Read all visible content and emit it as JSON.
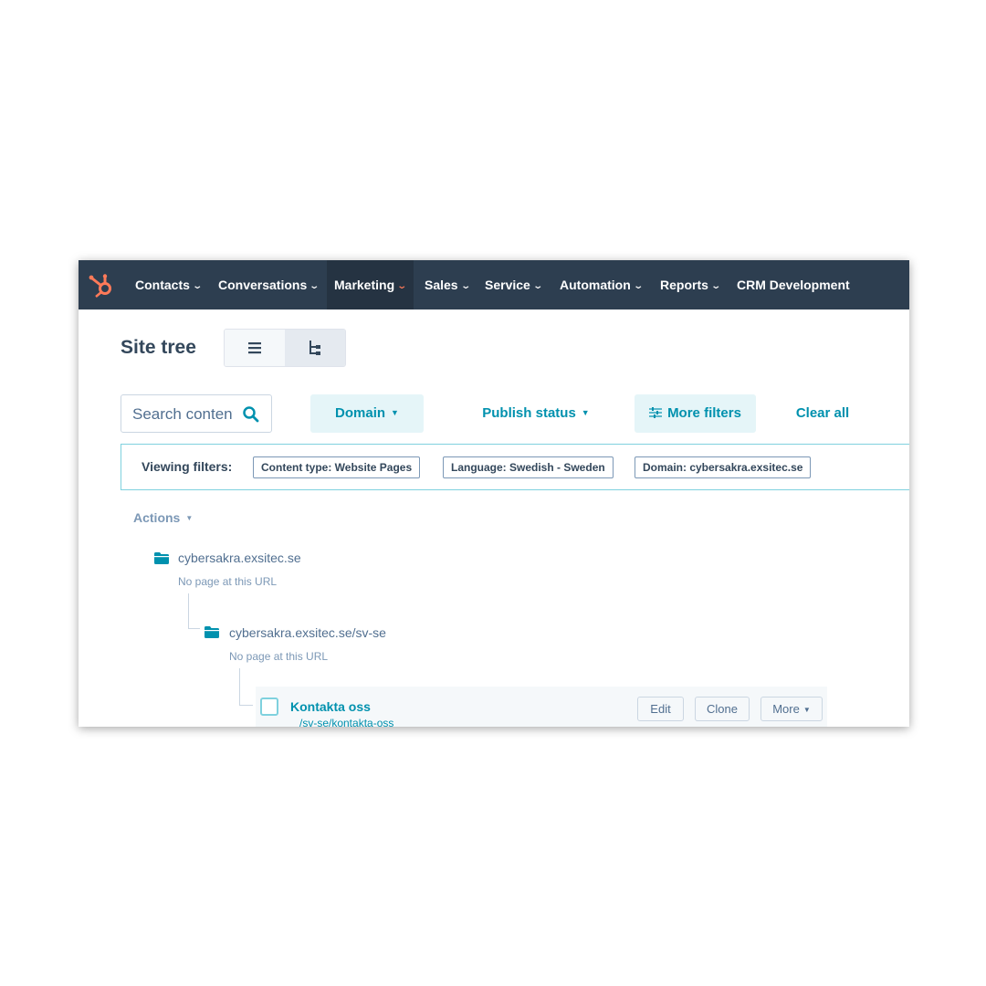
{
  "colors": {
    "nav_background": "#2d3e50",
    "accent": "#ff7a59",
    "link": "#0091ae",
    "text": "#33475b"
  },
  "nav": {
    "logo_icon": "hubspot-sprocket-icon",
    "items": [
      {
        "label": "Contacts",
        "has_dropdown": true,
        "active": false
      },
      {
        "label": "Conversations",
        "has_dropdown": true,
        "active": false
      },
      {
        "label": "Marketing",
        "has_dropdown": true,
        "active": true
      },
      {
        "label": "Sales",
        "has_dropdown": true,
        "active": false
      },
      {
        "label": "Service",
        "has_dropdown": true,
        "active": false
      },
      {
        "label": "Automation",
        "has_dropdown": true,
        "active": false
      },
      {
        "label": "Reports",
        "has_dropdown": true,
        "active": false
      },
      {
        "label": "CRM Development",
        "has_dropdown": false,
        "active": false
      }
    ]
  },
  "header": {
    "title": "Site tree",
    "view_toggle": [
      {
        "icon": "list-view-icon",
        "selected": true
      },
      {
        "icon": "tree-view-icon",
        "selected": false
      }
    ]
  },
  "filters": {
    "search_placeholder": "Search content",
    "search_icon": "search-icon",
    "domain_label": "Domain",
    "publish_status_label": "Publish status",
    "more_filters_label": "More filters",
    "more_filters_icon": "sliders-icon",
    "clear_all_label": "Clear all"
  },
  "viewing_filters": {
    "label": "Viewing filters:",
    "chips": [
      "Content type: Website Pages",
      "Language: Swedish - Sweden",
      "Domain: cybersakra.exsitec.se"
    ]
  },
  "actions": {
    "label": "Actions"
  },
  "tree": {
    "root": {
      "icon": "folder-icon",
      "name": "cybersakra.exsitec.se",
      "subtext": "No page at this URL"
    },
    "child": {
      "icon": "folder-icon",
      "name": "cybersakra.exsitec.se/sv-se",
      "subtext": "No page at this URL"
    },
    "page": {
      "name": "Kontakta oss",
      "url": "/sv-se/kontakta-oss",
      "edit_label": "Edit",
      "clone_label": "Clone",
      "more_label": "More"
    }
  }
}
